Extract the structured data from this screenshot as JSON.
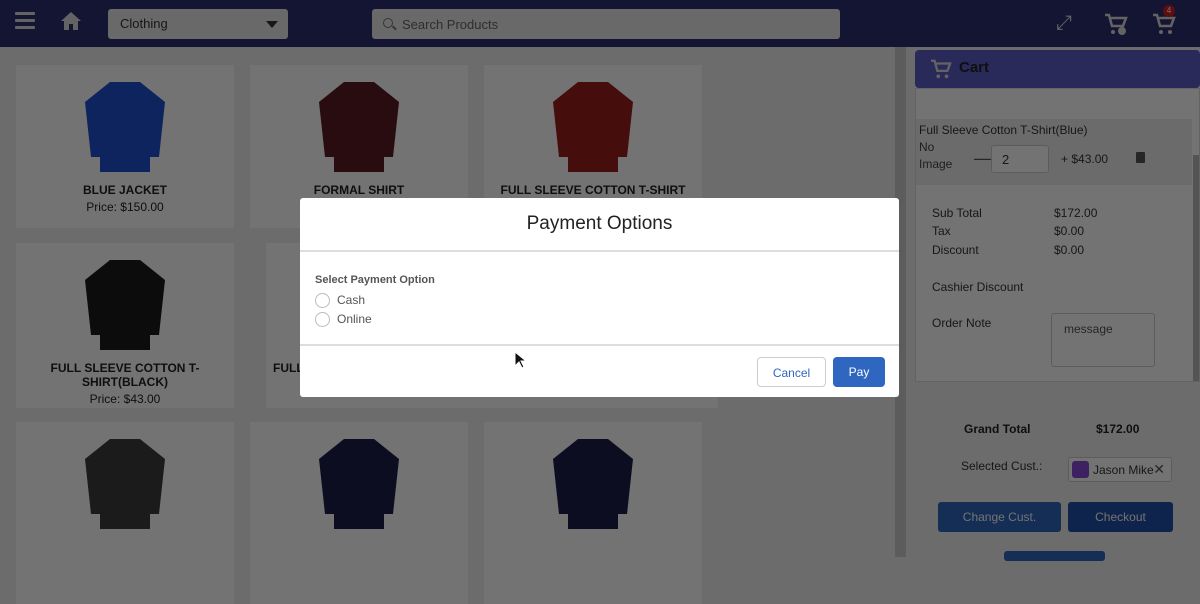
{
  "header": {
    "category": "Clothing",
    "search_placeholder": "Search Products",
    "cart_count": "4",
    "icons": [
      "menu-icon",
      "home-icon",
      "fullscreen-icon",
      "cart-check-icon",
      "cart-icon"
    ]
  },
  "products": [
    {
      "name": "BLUE JACKET",
      "price": "Price: $150.00",
      "color": "#1f4fd1"
    },
    {
      "name": "FORMAL SHIRT",
      "price": "",
      "color": "#5a1a22"
    },
    {
      "name": "FULL SLEEVE COTTON T-SHIRT",
      "price": "",
      "color": "#9b1c1c"
    },
    {
      "name": "FULL SLEEVE COTTON T-SHIRT(BLACK)",
      "price": "Price: $43.00",
      "color": "#1a1a1a"
    },
    {
      "name": "FULL",
      "price": "",
      "color": "#333"
    },
    {
      "name": "",
      "price": "",
      "color": "#333"
    },
    {
      "name": "",
      "price": "",
      "color": "#3b3b3b"
    },
    {
      "name": "",
      "price": "",
      "color": "#1c1d4a"
    },
    {
      "name": "",
      "price": "",
      "color": "#1c1d4a"
    }
  ],
  "cart": {
    "title": "Cart",
    "item": {
      "name": "Full Sleeve Cotton T-Shirt(Blue)",
      "image_alt": "No Image",
      "qty": "2",
      "price": "+ $43.00"
    },
    "sub_total_label": "Sub Total",
    "sub_total": "$172.00",
    "tax_label": "Tax",
    "tax": "$0.00",
    "discount_label": "Discount",
    "discount": "$0.00",
    "cashier_discount_label": "Cashier Discount",
    "order_note_label": "Order Note",
    "order_note_placeholder": "message",
    "grand_total_label": "Grand Total",
    "grand_total": "$172.00",
    "selected_customer_label": "Selected Cust.:",
    "customer": "Jason Mike",
    "change_customer": "Change Cust.",
    "checkout": "Checkout"
  },
  "modal": {
    "title": "Payment Options",
    "label": "Select Payment Option",
    "options": [
      "Cash",
      "Online"
    ],
    "cancel": "Cancel",
    "pay": "Pay"
  }
}
